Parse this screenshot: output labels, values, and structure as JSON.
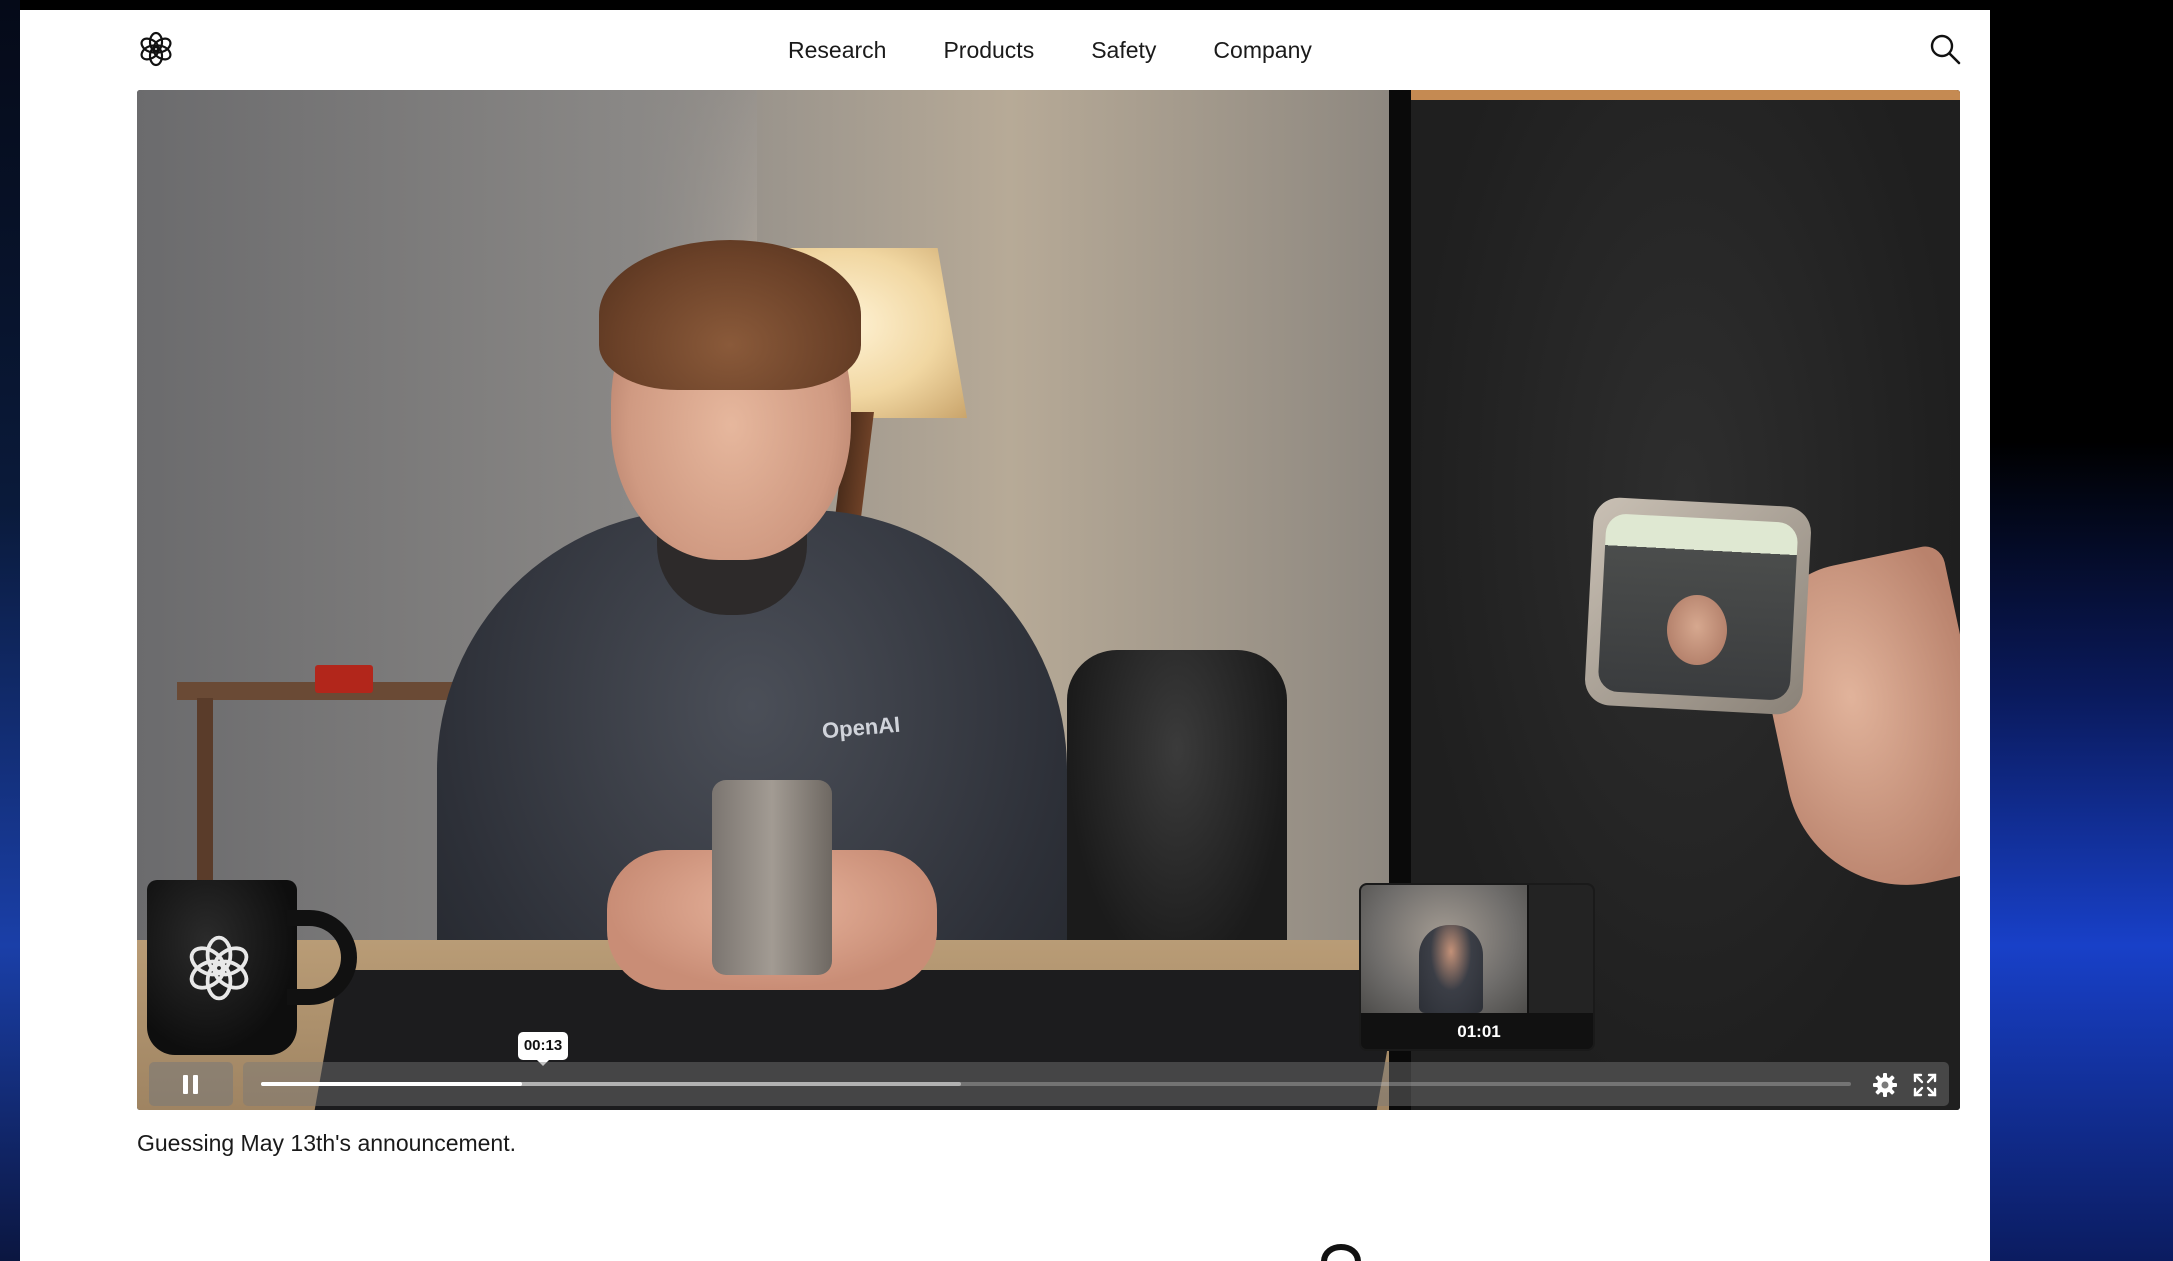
{
  "header": {
    "nav": [
      "Research",
      "Products",
      "Safety",
      "Company"
    ]
  },
  "video": {
    "shirt_text": "OpenAI",
    "tooltip_time": "00:13",
    "preview_time": "01:01",
    "progress_fraction": 0.164,
    "buffered_fraction": 0.44
  },
  "caption": "Guessing May 13th's announcement.",
  "icons": {
    "logo": "openai-logo-icon",
    "search": "search-icon",
    "pause": "pause-icon",
    "settings": "gear-icon",
    "fullscreen": "fullscreen-icon"
  },
  "colors": {
    "text": "#1a1a1a",
    "page_bg": "#ffffff",
    "progress": "#ffffff"
  }
}
